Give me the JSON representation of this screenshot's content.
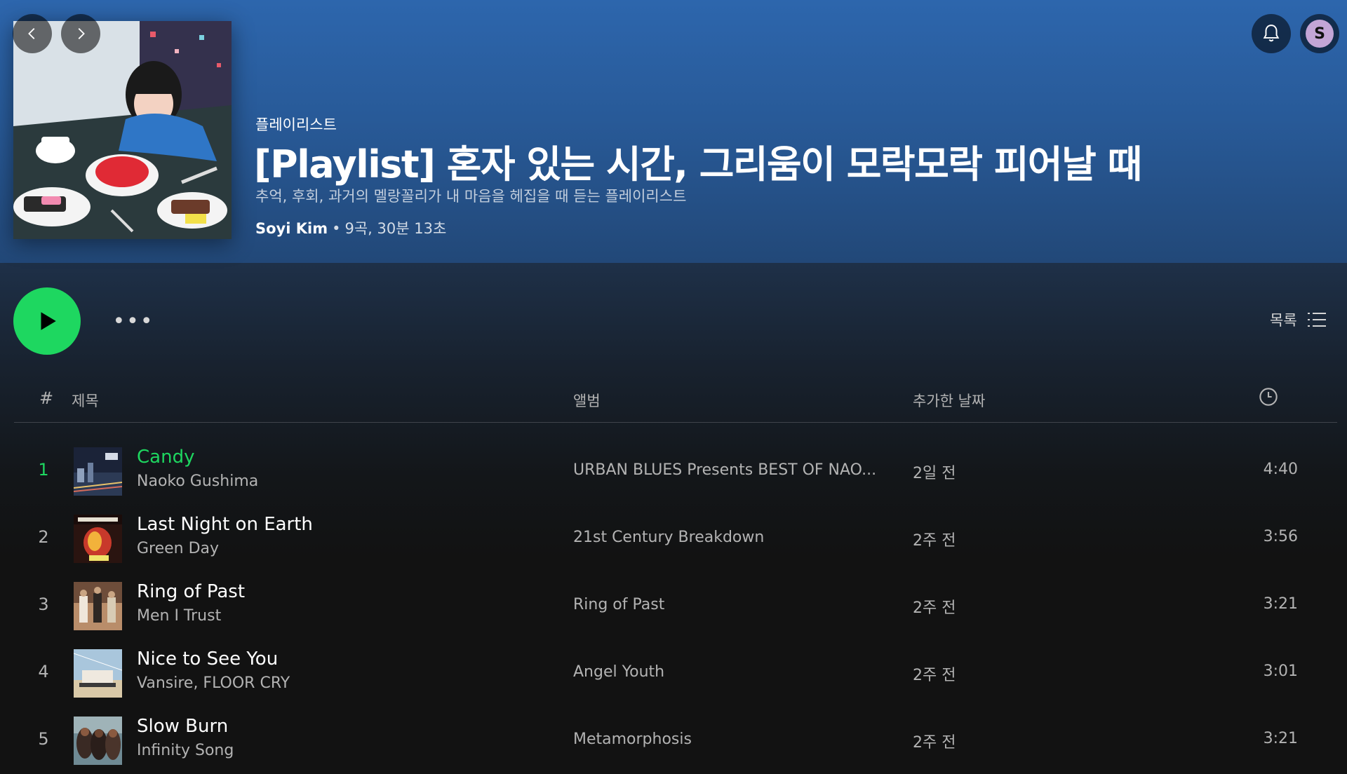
{
  "header": {
    "type_label": "플레이리스트",
    "title": "[Playlist] 혼자 있는 시간, 그리움이 모락모락 피어날 때",
    "description": "추억, 후회, 과거의 멜랑꼴리가 내 마음을 헤집을 때 듣는 플레이리스트",
    "owner": "Soyi Kim",
    "meta_separator": "•",
    "stats": "9곡, 30분 13초",
    "avatar_initial": "S"
  },
  "icons": {
    "back": "chevron-left-icon",
    "forward": "chevron-right-icon",
    "notifications": "bell-icon",
    "play": "play-icon",
    "more": "more-horizontal-icon",
    "list_view": "list-icon",
    "duration": "clock-icon"
  },
  "actions": {
    "more_label": "•••",
    "view_label": "목록"
  },
  "table": {
    "columns": {
      "number": "#",
      "title": "제목",
      "album": "앨범",
      "date_added": "추가한 날짜"
    },
    "rows": [
      {
        "num": "1",
        "title": "Candy",
        "artist": "Naoko Gushima",
        "album": "URBAN BLUES Presents BEST OF NAO...",
        "date": "2일 전",
        "duration": "4:40",
        "playing": true
      },
      {
        "num": "2",
        "title": "Last Night on Earth",
        "artist": "Green Day",
        "album": "21st Century Breakdown",
        "date": "2주 전",
        "duration": "3:56",
        "playing": false
      },
      {
        "num": "3",
        "title": "Ring of Past",
        "artist": "Men I Trust",
        "album": "Ring of Past",
        "date": "2주 전",
        "duration": "3:21",
        "playing": false
      },
      {
        "num": "4",
        "title": "Nice to See You",
        "artist": "Vansire, FLOOR CRY",
        "album": "Angel Youth",
        "date": "2주 전",
        "duration": "3:01",
        "playing": false
      },
      {
        "num": "5",
        "title": "Slow Burn",
        "artist": "Infinity Song",
        "album": "Metamorphosis",
        "date": "2주 전",
        "duration": "3:21",
        "playing": false
      }
    ]
  },
  "colors": {
    "accent_green": "#1ed760",
    "header_blue": "#2d66ad",
    "background": "#121212",
    "avatar": "#c3a5d6"
  }
}
